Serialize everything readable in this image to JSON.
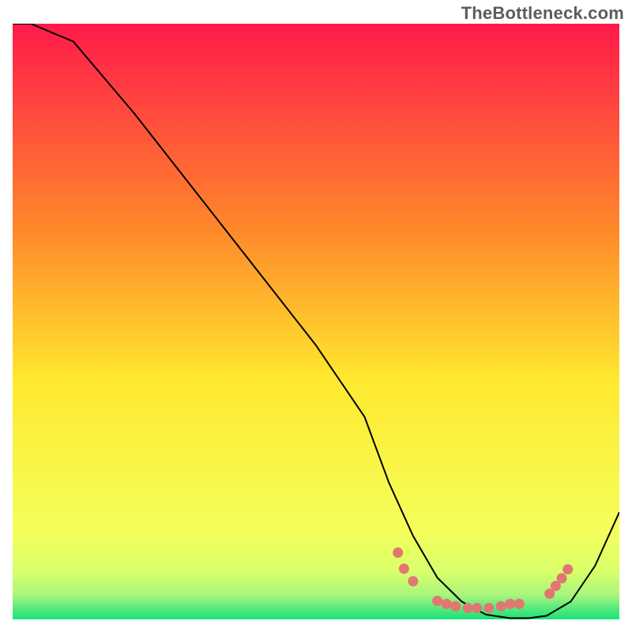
{
  "watermark": "TheBottleneck.com",
  "chart_data": {
    "type": "line",
    "title": "",
    "xlabel": "",
    "ylabel": "",
    "xlim": [
      0,
      100
    ],
    "ylim": [
      0,
      100
    ],
    "background": {
      "style": "vertical-gradient",
      "top_color": "#ff1a4b",
      "mid_color": "#ffe92f",
      "low_color": "#d9ff6b",
      "bottom_color": "#19e07a"
    },
    "series": [
      {
        "name": "bottleneck-curve",
        "x": [
          0,
          3,
          10,
          20,
          30,
          40,
          50,
          58,
          62,
          66,
          70,
          74,
          78,
          82,
          85,
          88,
          92,
          96,
          100
        ],
        "y": [
          100,
          100,
          97,
          85,
          72,
          59,
          46,
          34,
          23,
          14,
          7,
          3,
          0.8,
          0.2,
          0.2,
          0.6,
          3,
          9,
          18
        ],
        "color": "#000000",
        "stroke_width": 2
      }
    ],
    "markers": {
      "name": "highlight-dots",
      "color": "#e27671",
      "radius": 6.5,
      "points": [
        {
          "x": 63.5,
          "y": 11.2
        },
        {
          "x": 64.5,
          "y": 8.5
        },
        {
          "x": 66.0,
          "y": 6.4
        },
        {
          "x": 70.0,
          "y": 3.1
        },
        {
          "x": 71.5,
          "y": 2.6
        },
        {
          "x": 73.0,
          "y": 2.2
        },
        {
          "x": 75.0,
          "y": 1.9
        },
        {
          "x": 76.5,
          "y": 1.9
        },
        {
          "x": 78.5,
          "y": 1.9
        },
        {
          "x": 80.5,
          "y": 2.2
        },
        {
          "x": 82.0,
          "y": 2.6
        },
        {
          "x": 83.5,
          "y": 2.6
        },
        {
          "x": 88.5,
          "y": 4.3
        },
        {
          "x": 89.5,
          "y": 5.6
        },
        {
          "x": 90.5,
          "y": 6.9
        },
        {
          "x": 91.5,
          "y": 8.4
        }
      ]
    }
  }
}
